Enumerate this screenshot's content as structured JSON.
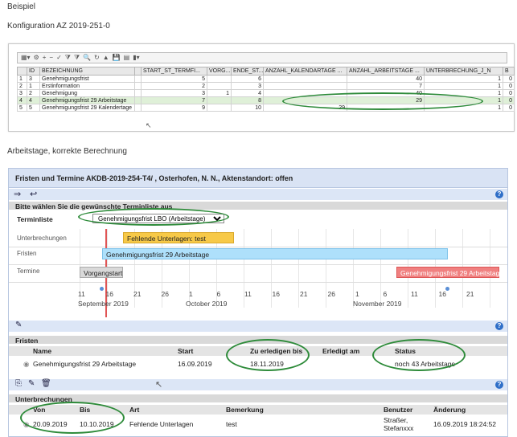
{
  "captions": {
    "beispiel": "Beispiel",
    "konfiguration": "Konfiguration AZ 2019-251-0",
    "arbeitstage": "Arbeitstage, korrekte Berechnung"
  },
  "grid": {
    "headers": [
      "",
      "ID",
      "BEZEICHNUNG",
      "",
      "START_ST_TERMFI...",
      "VORG...",
      "ENDE_ST...",
      "ANZAHL_KALENDARTAGE ...",
      "ANZAHL_ARBEITSTAGE ...",
      "UNTERBRECHUNG_J_N",
      "B"
    ],
    "rows": [
      {
        "rownum": "1",
        "id": "3",
        "name": "Genehmigungsfrist",
        "start": "5",
        "vorg": "",
        "ende": "6",
        "kal": "",
        "arb": "40",
        "unt": "1",
        "b": "0"
      },
      {
        "rownum": "2",
        "id": "1",
        "name": "Erstinformation",
        "start": "2",
        "vorg": "",
        "ende": "3",
        "kal": "",
        "arb": "7",
        "unt": "1",
        "b": "0"
      },
      {
        "rownum": "3",
        "id": "2",
        "name": "Genehmigung",
        "start": "3",
        "vorg": "1",
        "ende": "4",
        "kal": "",
        "arb": "40",
        "unt": "1",
        "b": "0"
      },
      {
        "rownum": "4",
        "id": "4",
        "name": "Genehmigungsfrist 29 Arbeitstage",
        "start": "7",
        "vorg": "",
        "ende": "8",
        "kal": "",
        "arb": "29",
        "unt": "1",
        "b": "0"
      },
      {
        "rownum": "5",
        "id": "5",
        "name": "Genehmigungsfrist 29 Kalendertage",
        "start": "9",
        "vorg": "",
        "ende": "10",
        "kal": "29",
        "arb": "",
        "unt": "1",
        "b": "0"
      }
    ]
  },
  "panel": {
    "title": "Fristen und Termine AKDB-2019-254-T4/ , Osterhofen, N. N., Aktenstandort: offen",
    "prompt": "Bitte wählen Sie die gewünschte Terminliste aus",
    "terminliste_label": "Terminliste",
    "terminliste_value": "Genehmigungsfrist LBO (Arbeitstage)",
    "timeline": {
      "row_labels": [
        "Unterbrechungen",
        "Fristen",
        "Termine"
      ],
      "ev_unterbrechung": "Fehlende Unterlagen: test",
      "ev_frist": "Genehmigungsfrist 29 Arbeitstage",
      "ev_vorgangstart": "Vorgangstart",
      "ev_termin": "Genehmigungsfrist 29 Arbeitstage",
      "day_ticks": [
        "11",
        "16",
        "21",
        "26",
        "1",
        "6",
        "11",
        "16",
        "21",
        "26",
        "1",
        "6",
        "11",
        "16",
        "21"
      ],
      "months": [
        "September 2019",
        "October 2019",
        "November 2019"
      ]
    },
    "fristen": {
      "heading": "Fristen",
      "columns": [
        "Name",
        "Start",
        "Zu erledigen bis",
        "Erledigt am",
        "Status"
      ],
      "row": {
        "name": "Genehmigungsfrist 29 Arbeitstage",
        "start": "16.09.2019",
        "due": "18.11.2019",
        "done": "",
        "status": "noch 43 Arbeitstage"
      }
    },
    "unterbrechungen": {
      "heading": "Unterbrechungen",
      "columns": [
        "Von",
        "Bis",
        "Art",
        "Bemerkung",
        "Benutzer",
        "Änderung"
      ],
      "row": {
        "von": "20.09.2019",
        "bis": "10.10.2019",
        "art": "Fehlende Unterlagen",
        "bemerkung": "test",
        "benutzer": "Straßer, Stefanxxx",
        "aenderung": "16.09.2019 18:24:52"
      }
    }
  },
  "colors": {
    "highlight_ellipse": "#2e8b3a",
    "unterbrechung_bar": "#f7c948",
    "frist_bar": "#aee0fb",
    "termin_bar": "#f08080",
    "today_line": "#e05555",
    "header_blue": "#d9e3f4"
  },
  "icons": [
    "grid-icon",
    "filter-icon",
    "search-icon",
    "save-icon",
    "help-icon",
    "forward-icon",
    "back-icon",
    "edit-icon",
    "delete-icon"
  ]
}
